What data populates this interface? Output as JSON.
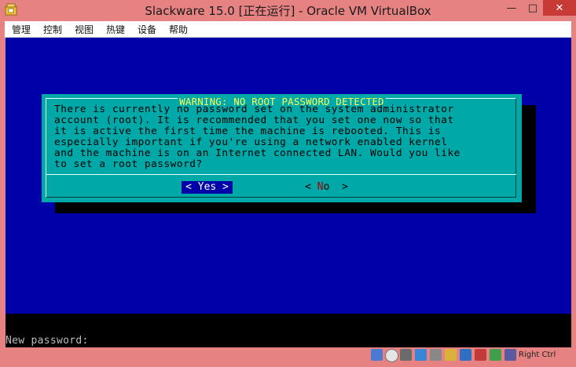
{
  "window": {
    "title": "Slackware 15.0 [正在运行] - Oracle VM VirtualBox",
    "minimize_glyph": "—",
    "maximize_glyph": "□",
    "close_glyph": "✕"
  },
  "menubar": {
    "items": [
      "管理",
      "控制",
      "视图",
      "热键",
      "设备",
      "帮助"
    ]
  },
  "dialog": {
    "title": "WARNING: NO ROOT PASSWORD DETECTED",
    "body_lines": [
      "There is currently no password set on the system administrator",
      "account (root). It is recommended that you set one now so that",
      "it is active the first time the machine is rebooted. This is",
      "especially important if you're using a network enabled kernel",
      "and the machine is on an Internet connected LAN. Would you like",
      "to set a root password?"
    ],
    "yes_label": "< Yes >",
    "no_label_left": "< ",
    "no_label_hot": "N",
    "no_label_rest": "o  >"
  },
  "console": {
    "prompt": "New password:"
  },
  "statusbar": {
    "host_key": "Right Ctrl",
    "icons": [
      "hdd-icon",
      "optical-drive-icon",
      "audio-icon",
      "network-icon",
      "usb-icon",
      "shared-folders-icon",
      "display-icon",
      "recording-icon",
      "cpu-icon",
      "mouse-integration-icon",
      "keyboard-icon"
    ]
  },
  "colors": {
    "frame": "#e68282",
    "console_bg": "#0000a8",
    "dialog_bg": "#00a8a8",
    "dialog_title": "#ffff54",
    "close_button": "#c73a36"
  }
}
